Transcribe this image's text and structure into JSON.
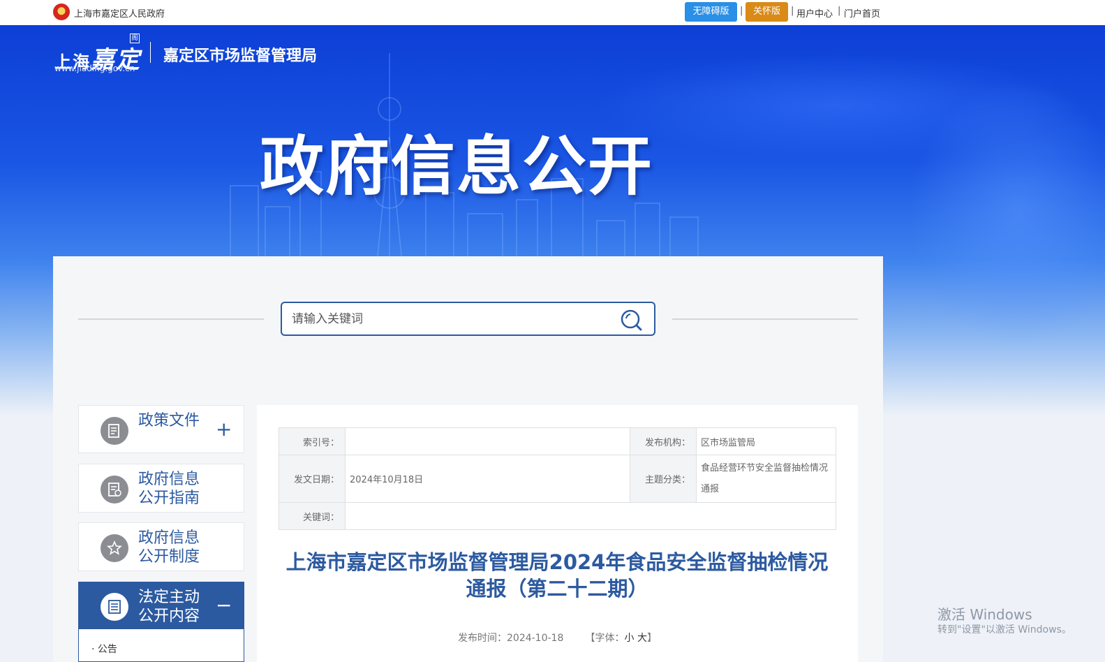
{
  "topbar": {
    "gov_name": "上海市嘉定区人民政府",
    "accessibility_btn": "无障碍版",
    "care_btn": "关怀版",
    "sep": "|",
    "user_center": "用户中心",
    "portal_home": "门户首页",
    "accessibility_color": "#2a8fe6",
    "care_color": "#d98a17"
  },
  "banner": {
    "logo_shanghai": "上海",
    "logo_jiading": "嘉定",
    "logo_tag": "阁",
    "logo_url": "www.jiading.gov.cn",
    "bureau_name": "嘉定区市场监督管理局",
    "hero_title": "政府信息公开"
  },
  "search": {
    "placeholder": "请输入关键词"
  },
  "sidebar": {
    "items": [
      {
        "label_l1": "政策文件",
        "label_l2": "",
        "toggle": "+"
      },
      {
        "label_l1": "政府信息",
        "label_l2": "公开指南",
        "toggle": ""
      },
      {
        "label_l1": "政府信息",
        "label_l2": "公开制度",
        "toggle": ""
      },
      {
        "label_l1": "法定主动",
        "label_l2": "公开内容",
        "toggle": "−"
      }
    ],
    "sub_items": [
      "公告"
    ]
  },
  "article": {
    "meta": {
      "index_label": "索引号：",
      "index_value": "",
      "publisher_label": "发布机构：",
      "publisher_value": "区市场监管局",
      "date_label": "发文日期：",
      "date_value": "2024年10月18日",
      "topic_label": "主题分类：",
      "topic_value": "食品经营环节安全监督抽检情况通报",
      "keyword_label": "关键词：",
      "keyword_value": ""
    },
    "title": "上海市嘉定区市场监督管理局2024年食品安全监督抽检情况通报（第二十二期）",
    "publish_time_label": "发布时间：",
    "publish_time": "2024-10-18",
    "font_label_open": "【字体：",
    "font_small": "小",
    "font_large": "大",
    "font_label_close": "】"
  },
  "watermark": {
    "line1": "激活 Windows",
    "line2": "转到\"设置\"以激活 Windows。"
  }
}
